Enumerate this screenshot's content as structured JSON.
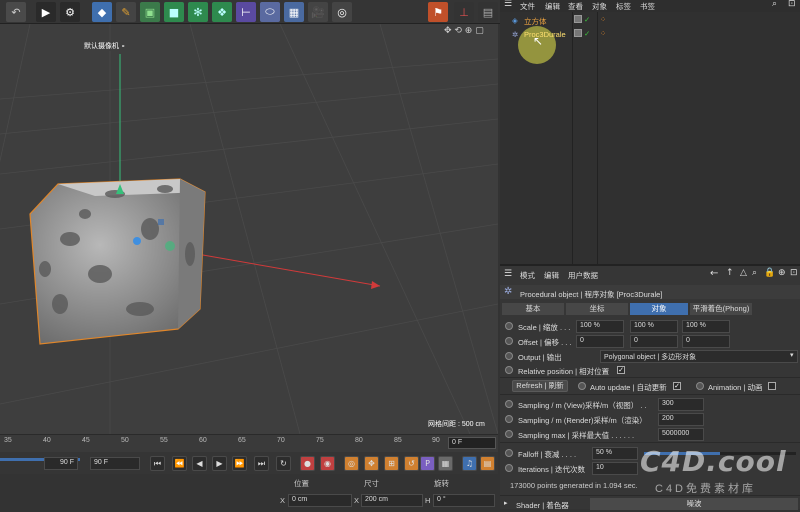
{
  "toolbar": {
    "tools": [
      "undo-icon",
      "render-region-icon",
      "render-view-icon",
      "render-settings-icon",
      "cube-primitive-icon",
      "pen-spline-icon",
      "subdivision-icon",
      "cube-icon",
      "node-icon",
      "cloner-icon",
      "deformer-icon",
      "floor-icon",
      "camera-icon",
      "light-icon",
      "bucket-icon",
      "axis-icon"
    ]
  },
  "viewport": {
    "camera_label": "默认摄像机 ∘",
    "grid_spacing": "网格间距 : 500 cm",
    "nav_icons": [
      "move-view-icon",
      "rotate-view-icon",
      "zoom-view-icon",
      "maximize-view-icon"
    ]
  },
  "timeline": {
    "ticks": [
      "35",
      "40",
      "45",
      "50",
      "55",
      "60",
      "65",
      "70",
      "75",
      "80",
      "85",
      "90"
    ],
    "current_frame": "0 F",
    "end_frame_left": "90 F",
    "end_frame_right": "90 F"
  },
  "coords": {
    "col_position": "位置",
    "col_size": "尺寸",
    "col_rotation": "旋转",
    "x_label": "X",
    "x_value": "0 cm",
    "size_x_label": "X",
    "size_x_value": "200 cm",
    "h_label": "H",
    "h_value": "0 °"
  },
  "object_manager": {
    "menu": [
      "文件",
      "编辑",
      "查看",
      "对象",
      "标签",
      "书签"
    ],
    "objects": [
      {
        "name": "立方体",
        "selected": false
      },
      {
        "name": "Proc3Durale",
        "selected": true
      }
    ]
  },
  "attributes": {
    "menu": [
      "模式",
      "编辑",
      "用户数据"
    ],
    "title": "Procedural object | 程序对象 [Proc3Durale]",
    "tabs": [
      "基本",
      "坐标",
      "对象",
      "平滑着色(Phong)"
    ],
    "active_tab": "对象",
    "scale_label": "Scale | 缩放 . . .",
    "scale_values": [
      "100 %",
      "100 %",
      "100 %"
    ],
    "offset_label": "Offset | 偏移 . . .",
    "offset_values": [
      "0",
      "0",
      "0"
    ],
    "output_label": "Output | 输出",
    "output_value": "Polygonal object | 多边形对象",
    "relative_label": "Relative position | 相对位置",
    "relative_checked": true,
    "refresh_button": "Refresh | 刷新",
    "auto_update_label": "Auto update | 自动更新",
    "auto_update_checked": true,
    "animation_label": "Animation | 动画",
    "animation_checked": false,
    "sampling_view_label": "Sampling / m (View)采样/m（视图） . .",
    "sampling_view_value": "300",
    "sampling_render_label": "Sampling / m (Render)采样/m（渲染）",
    "sampling_render_value": "200",
    "sampling_max_label": "Sampling max | 采样最大值 . . . . . .",
    "sampling_max_value": "5000000",
    "falloff_label": "Falloff | 衰减 . . . .",
    "falloff_value": "50 %",
    "falloff_fraction": 0.5,
    "iterations_label": "Iterations | 迭代次数",
    "iterations_value": "10",
    "status": "173000 points generated in 1.094 sec.",
    "shader_label": "Shader | 着色器",
    "shader_value": "噪波"
  },
  "watermark": {
    "logo": "C4D.cool",
    "subtitle": "C4D免费素材库"
  },
  "colors": {
    "accent_blue": "#3f6fae",
    "selection_yellow": "#e8e84a",
    "object_orange": "#e0862a",
    "axis_red": "#d23a3a",
    "axis_green": "#35c07a"
  }
}
